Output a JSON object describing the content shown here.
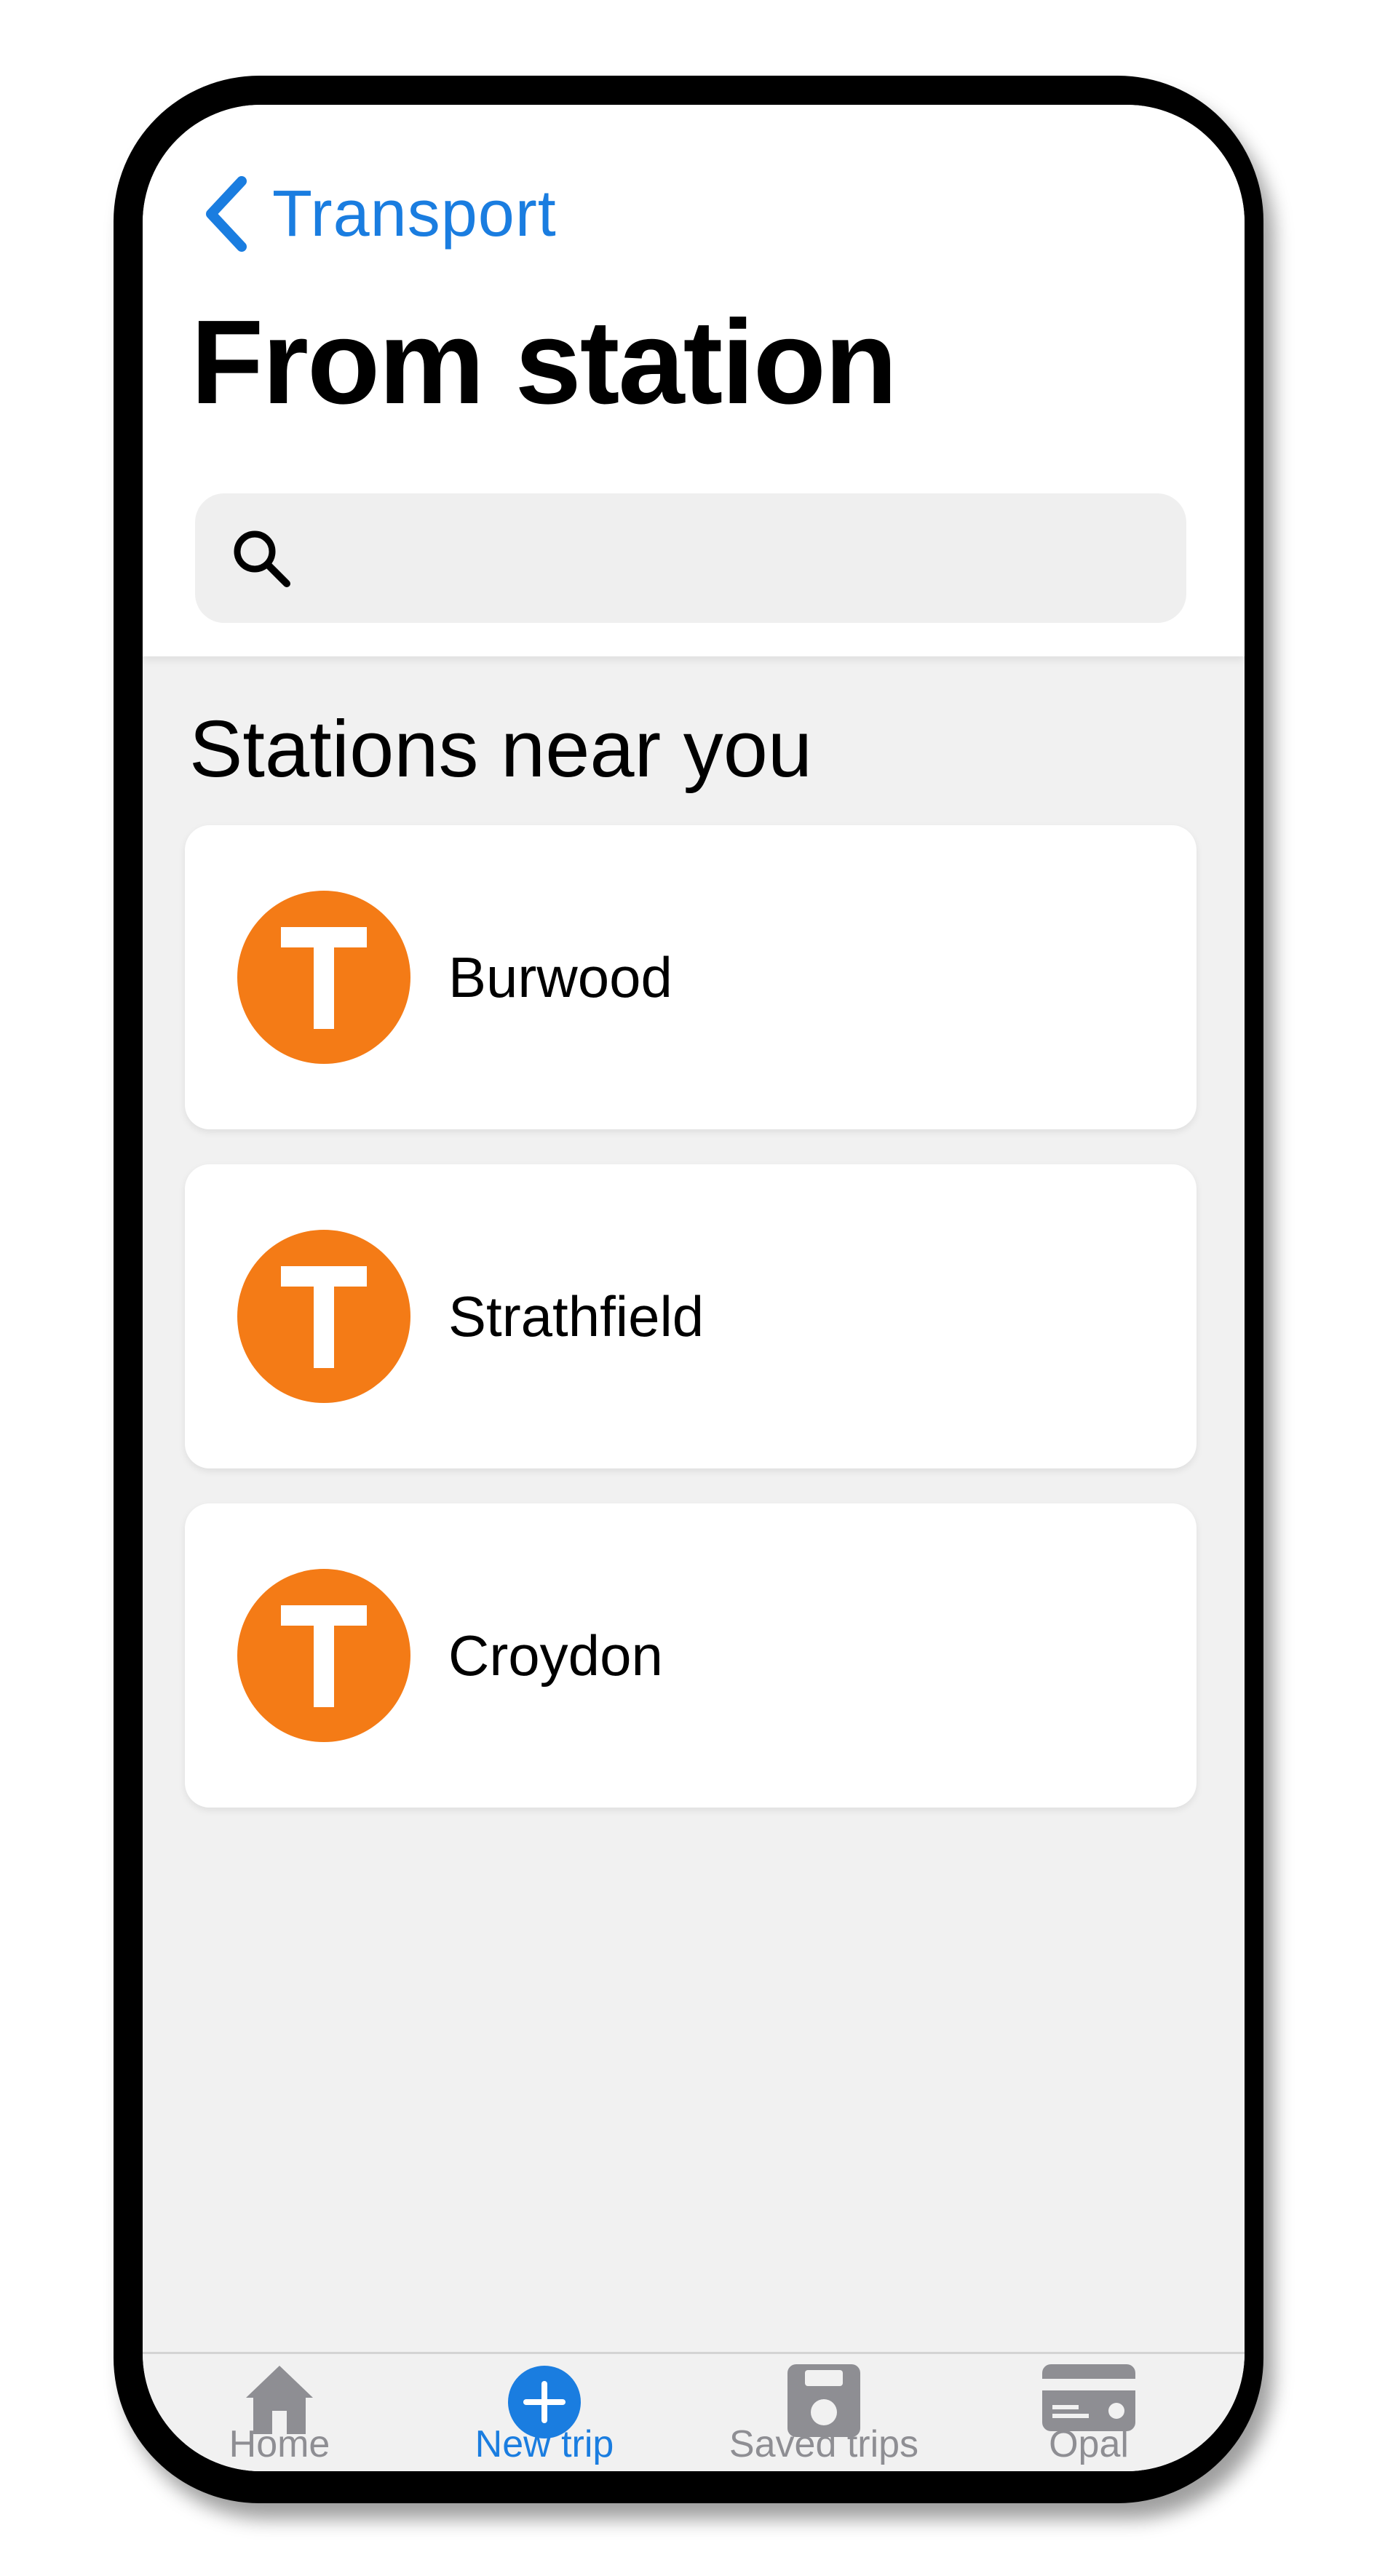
{
  "nav": {
    "back_label": "Transport"
  },
  "header": {
    "title": "From station"
  },
  "search": {
    "placeholder": "",
    "value": ""
  },
  "section": {
    "title": "Stations near you"
  },
  "stations": [
    {
      "name": "Burwood",
      "badge": "T"
    },
    {
      "name": "Strathfield",
      "badge": "T"
    },
    {
      "name": "Croydon",
      "badge": "T"
    }
  ],
  "tabs": [
    {
      "label": "Home",
      "icon": "home-icon",
      "active": false
    },
    {
      "label": "New trip",
      "icon": "plus-circle-icon",
      "active": true
    },
    {
      "label": "Saved trips",
      "icon": "floppy-disk-icon",
      "active": false
    },
    {
      "label": "Opal",
      "icon": "card-icon",
      "active": false
    }
  ],
  "colors": {
    "accent": "#1a7de0",
    "train_badge": "#f47b16",
    "inactive_tab": "#8e8e93",
    "background": "#f1f1f1"
  }
}
